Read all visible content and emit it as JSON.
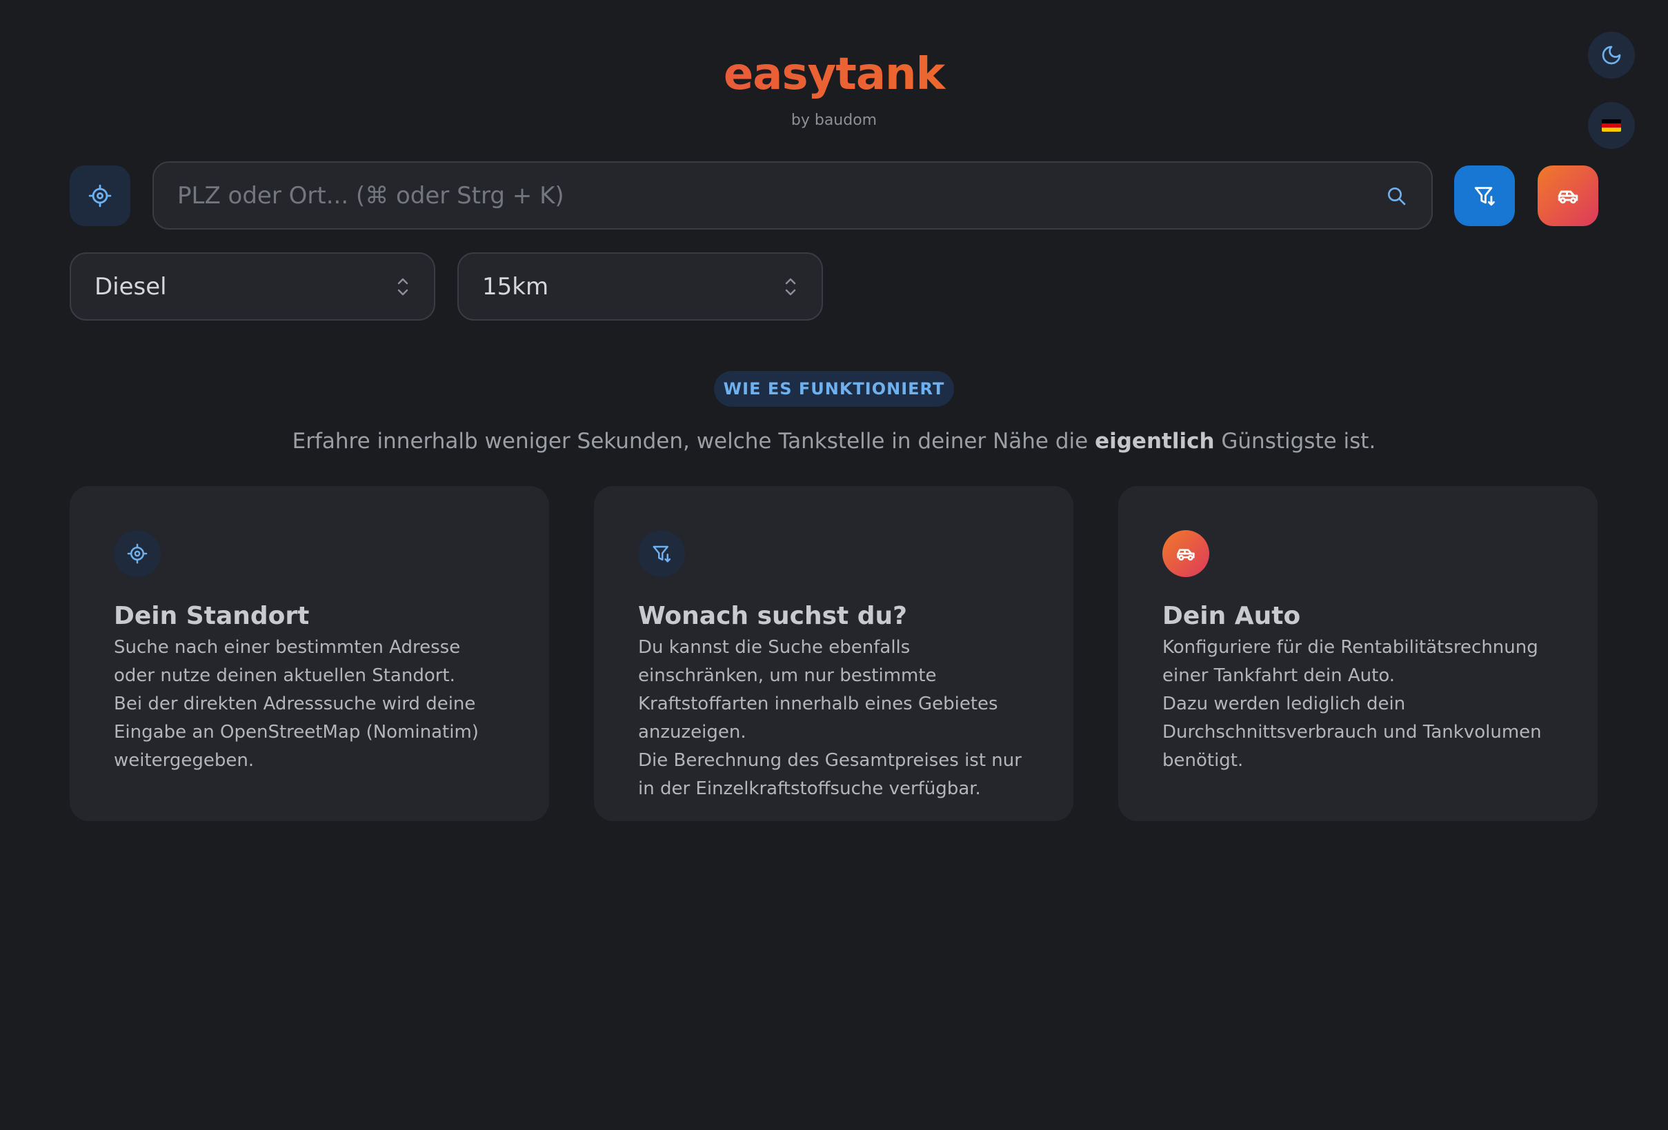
{
  "header": {
    "logo": "easytank",
    "byline": "by baudom"
  },
  "toolbar": {
    "theme_icon": "moon-icon",
    "language_icon": "german-flag-icon",
    "flag_colors": [
      "#000000",
      "#dd0000",
      "#ffcc00"
    ]
  },
  "search": {
    "placeholder": "PLZ oder Ort... (⌘ oder Strg + K)",
    "value": ""
  },
  "filters": {
    "fuel": "Diesel",
    "radius": "15km"
  },
  "how_it_works": {
    "badge": "WIE ES FUNKTIONIERT",
    "intro_before": "Erfahre innerhalb weniger Sekunden, welche Tankstelle in deiner Nähe die ",
    "intro_bold": "eigentlich",
    "intro_after": " Günstigste ist.",
    "cards": [
      {
        "icon": "crosshair-icon",
        "title": "Dein Standort",
        "text": "Suche nach einer bestimmten Adresse oder nutze deinen aktuellen Standort.\nBei der direkten Adresssuche wird deine Eingabe an OpenStreetMap (Nominatim) weitergegeben."
      },
      {
        "icon": "filter-icon",
        "title": "Wonach suchst du?",
        "text": "Du kannst die Suche ebenfalls einschränken, um nur bestimmte Kraftstoffarten innerhalb eines Gebietes anzuzeigen.\nDie Berechnung des Gesamtpreises ist nur in der Einzelkraftstoffsuche verfügbar."
      },
      {
        "icon": "car-icon",
        "title": "Dein Auto",
        "text": "Konfiguriere für die Rentabilitätsrechnung einer Tankfahrt dein Auto.\nDazu werden lediglich dein Durchschnittsverbrauch und Tankvolumen benötigt."
      }
    ]
  },
  "colors": {
    "background": "#1b1c20",
    "card": "#25262b",
    "accent_blue": "#1877d2",
    "accent_orange": "#f07a2a",
    "accent_pink": "#dd3a5c",
    "badge_text": "#6fb0ef"
  }
}
